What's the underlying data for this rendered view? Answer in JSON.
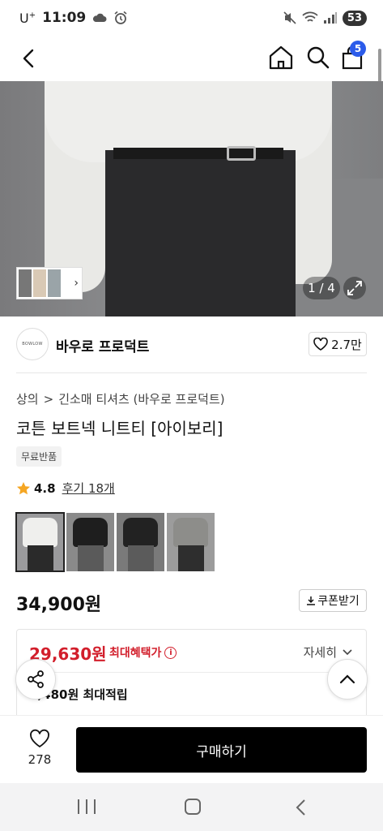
{
  "status_bar": {
    "carrier": "U",
    "carrier_sup": "+",
    "time": "11:09",
    "battery": "53"
  },
  "top_nav": {
    "cart_count": "5"
  },
  "hero": {
    "counter": "1 / 4"
  },
  "brand": {
    "logo_text": "BOWLOW",
    "name": "바우로 프로덕트",
    "likes": "2.7만"
  },
  "product": {
    "breadcrumb": [
      "상의",
      "긴소매 티셔츠 (바우로 프로덕트)"
    ],
    "title": "코튼 보트넥 니트티 [아이보리]",
    "return_badge": "무료반품",
    "rating": "4.8",
    "reviews": "후기 18개",
    "price": "34,900원",
    "coupon_label": "쿠폰받기"
  },
  "swatches": [
    {
      "body": "#efefed",
      "pants": "#2a2a2a",
      "bg": "#9a9a9c"
    },
    {
      "body": "#1e1e1e",
      "pants": "#5a5a5a",
      "bg": "#8a8a8a"
    },
    {
      "body": "#222222",
      "pants": "#5b5b5b",
      "bg": "#7a7a7a"
    },
    {
      "body": "#8d8d8a",
      "pants": "#2e2e2e",
      "bg": "#9c9c9c"
    }
  ],
  "benefit": {
    "price": "29,630원",
    "label": "최대혜택가",
    "detail_label": "자세히",
    "points": "1,480원 최대적립"
  },
  "bottom_bar": {
    "wish_count": "278",
    "buy_label": "구매하기"
  },
  "colors": {
    "accent_red": "#d21e2b",
    "badge_blue": "#2b5bea",
    "buy_button": "#000000"
  }
}
